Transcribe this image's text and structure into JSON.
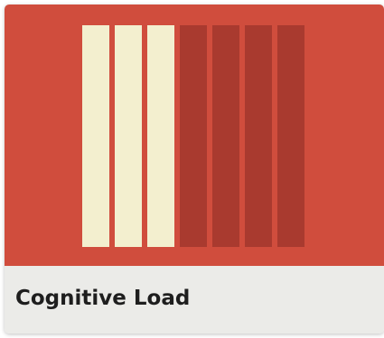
{
  "card": {
    "title": "Cognitive Load",
    "background_color": "#d04d3d",
    "footer_color": "#ebebe8",
    "icon": "load-meter-icon",
    "meter": {
      "total_segments": 7,
      "filled_segments": 3,
      "filled_color": "#f3efcf",
      "empty_color": "#a93a2f"
    }
  }
}
